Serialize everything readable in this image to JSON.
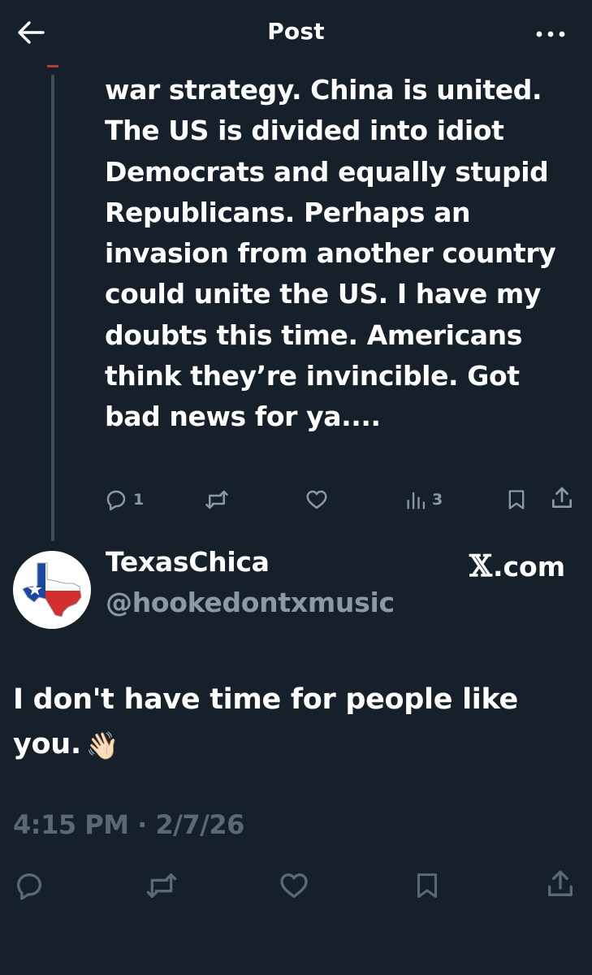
{
  "header": {
    "title": "Post",
    "back_icon": "arrow-left-icon",
    "more_icon": "more-horizontal-icon"
  },
  "parent_post": {
    "text": "war strategy. China is united. The US is divided into idiot Democrats and equally stupid Republicans. Perhaps an invasion from another country could unite the US. I have my doubts this time. Americans think they’re invincible. Got bad news for ya....",
    "actions": {
      "replies": "1",
      "reposts": "",
      "likes": "",
      "views": "3"
    }
  },
  "author": {
    "name": "TexasChica",
    "handle": "@hookedontxmusic",
    "avatar_icon": "texas-flag-map-icon"
  },
  "watermark": {
    "x": "𝕏",
    "domain": ".com"
  },
  "post": {
    "text": "I don't have time for people like you.",
    "emoji": "👋🏻",
    "timestamp": "4:15 PM · 2/7/26"
  },
  "colors": {
    "background": "#15202b",
    "primary_text": "#ffffff",
    "secondary_text": "#8b98a5",
    "muted_text": "#5b6975",
    "texas_red": "#d32f2f",
    "texas_blue": "#1a47a0"
  }
}
